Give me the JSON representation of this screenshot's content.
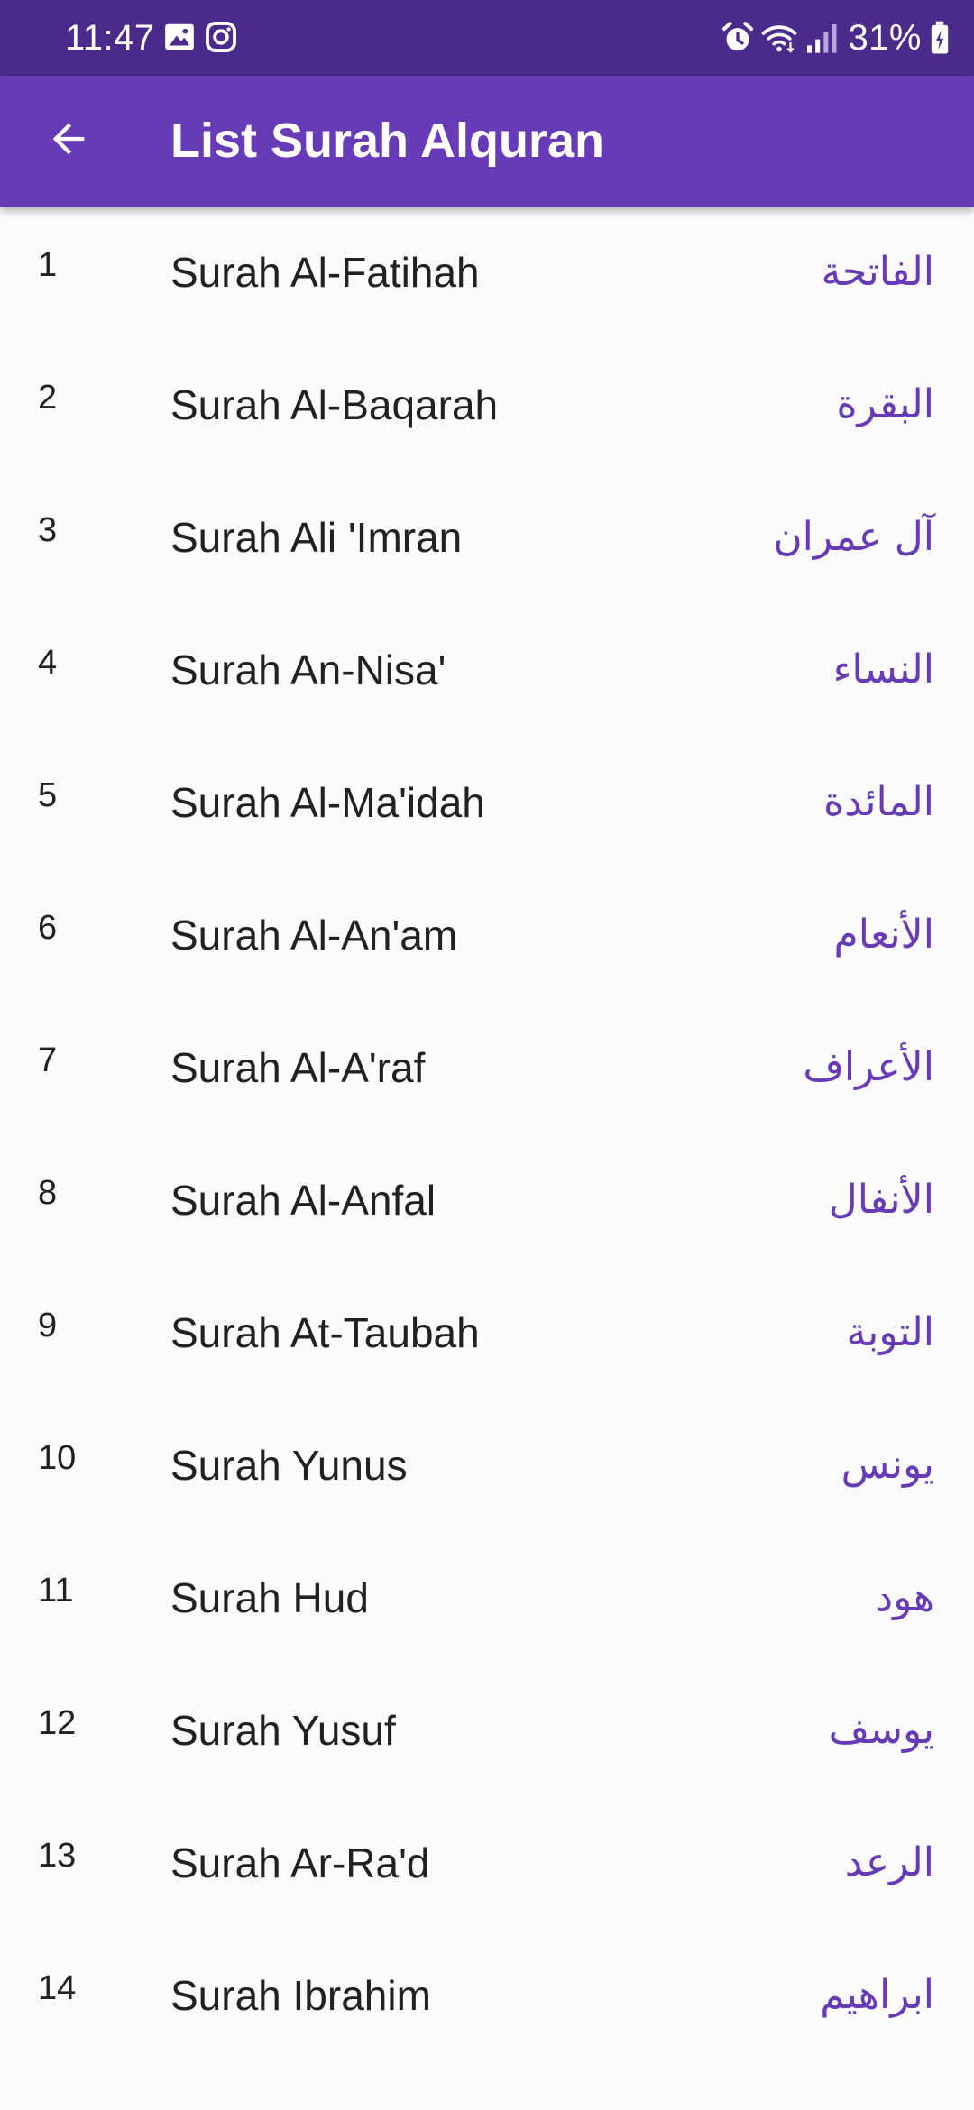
{
  "status_bar": {
    "time": "11:47",
    "battery": "31%",
    "icons_left": [
      "image-icon",
      "instagram-icon"
    ],
    "icons_right": [
      "alarm-icon",
      "wifi-icon",
      "signal-icon",
      "battery-charging-icon"
    ]
  },
  "app_bar": {
    "title": "List Surah Alquran",
    "back_icon": "arrow-back-icon",
    "background": "#673ab7"
  },
  "colors": {
    "status_bar": "#4a2b8c",
    "accent": "#673ab7",
    "text": "#212121",
    "background": "#fafafa"
  },
  "surahs": [
    {
      "number": "1",
      "name": "Surah Al-Fatihah",
      "arabic": "الفاتحة"
    },
    {
      "number": "2",
      "name": "Surah Al-Baqarah",
      "arabic": "البقرة"
    },
    {
      "number": "3",
      "name": "Surah Ali 'Imran",
      "arabic": "آل عمران"
    },
    {
      "number": "4",
      "name": "Surah An-Nisa'",
      "arabic": "النساء"
    },
    {
      "number": "5",
      "name": "Surah Al-Ma'idah",
      "arabic": "المائدة"
    },
    {
      "number": "6",
      "name": "Surah Al-An'am",
      "arabic": "الأنعام"
    },
    {
      "number": "7",
      "name": "Surah Al-A'raf",
      "arabic": "الأعراف"
    },
    {
      "number": "8",
      "name": "Surah Al-Anfal",
      "arabic": "الأنفال"
    },
    {
      "number": "9",
      "name": "Surah At-Taubah",
      "arabic": "التوبة"
    },
    {
      "number": "10",
      "name": "Surah Yunus",
      "arabic": "يونس"
    },
    {
      "number": "11",
      "name": "Surah Hud",
      "arabic": "هود"
    },
    {
      "number": "12",
      "name": "Surah Yusuf",
      "arabic": "يوسف"
    },
    {
      "number": "13",
      "name": "Surah Ar-Ra'd",
      "arabic": "الرعد"
    },
    {
      "number": "14",
      "name": "Surah Ibrahim",
      "arabic": "ابراهيم"
    }
  ]
}
